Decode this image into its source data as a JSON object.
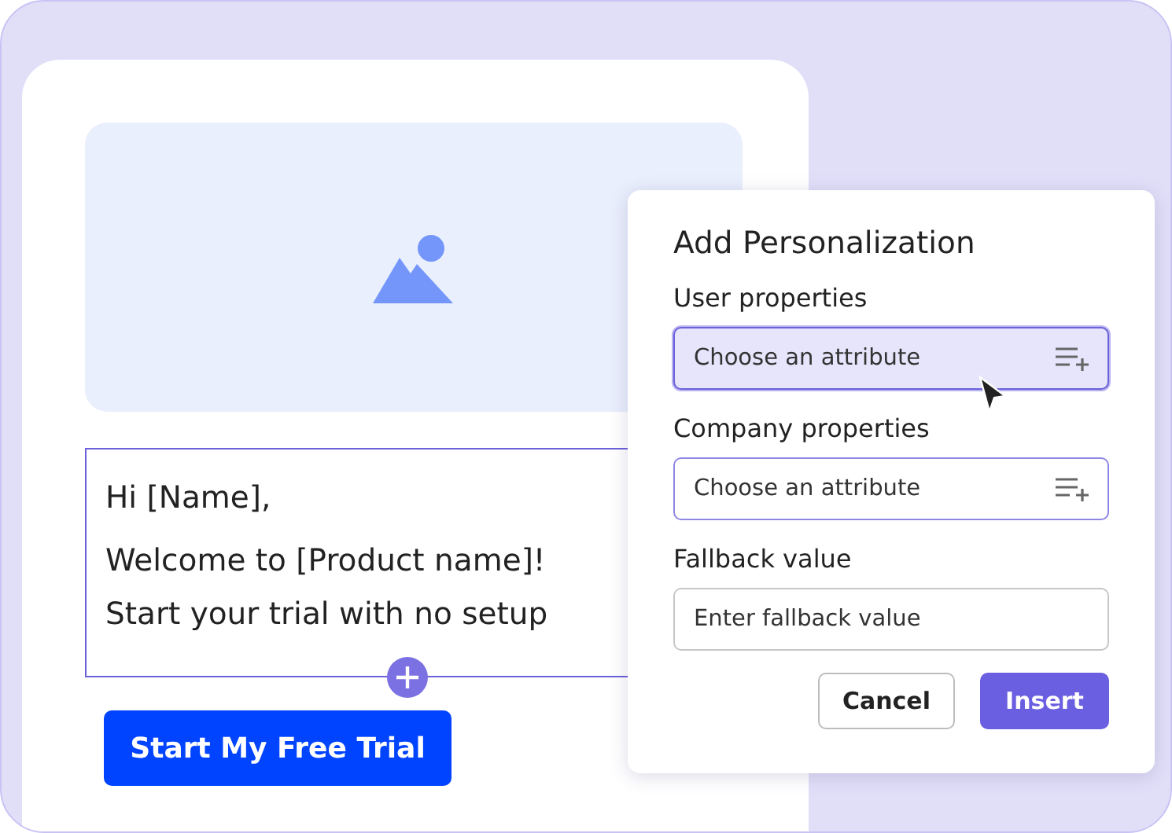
{
  "email": {
    "image": {
      "kind": "placeholder"
    },
    "lines": [
      {
        "text": "Hi [Name],"
      },
      {
        "text": "Welcome to [Product name]!"
      },
      {
        "text": "Start your trial with no setup"
      }
    ],
    "button": {
      "label": "Start My Free Trial"
    }
  },
  "dialog": {
    "title": "Add Personalization",
    "fields": [
      {
        "label": "User properties",
        "kind": "select",
        "placeholder": "Choose an attribute",
        "hovered": true
      },
      {
        "label": "Company properties",
        "kind": "select",
        "placeholder": "Choose an attribute",
        "hovered": false
      },
      {
        "label": "Fallback value",
        "kind": "text",
        "placeholder": "Enter fallback value",
        "hovered": false
      }
    ],
    "buttons": [
      {
        "label": "Cancel",
        "kind": "secondary"
      },
      {
        "label": "Insert",
        "kind": "primary"
      }
    ]
  }
}
